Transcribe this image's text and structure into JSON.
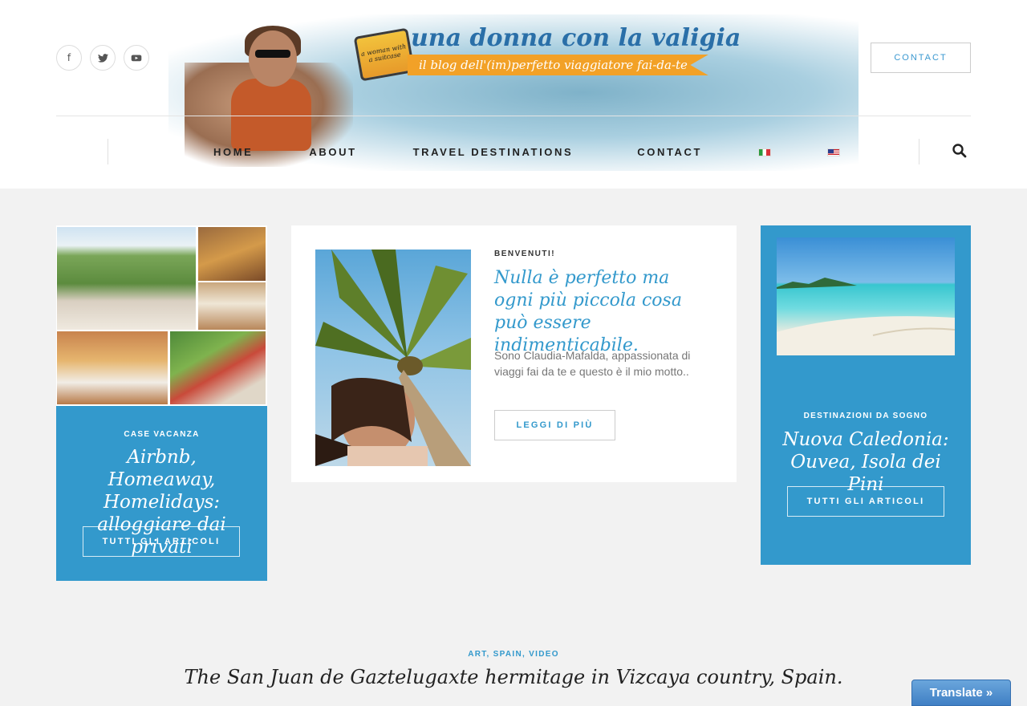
{
  "social": {
    "facebook": "f",
    "twitter": "t",
    "youtube": "▶"
  },
  "logo": {
    "title": "una donna con la valigia",
    "tagline": "il blog dell'(im)perfetto viaggiatore fai-da-te",
    "suitcase_text": "a woman with a suitcase"
  },
  "header": {
    "contact_button": "CONTACT"
  },
  "nav": {
    "items": [
      "HOME",
      "ABOUT",
      "TRAVEL DESTINATIONS",
      "CONTACT"
    ],
    "languages": [
      "it-flag",
      "us-flag"
    ]
  },
  "card_left": {
    "category": "CASE VACANZA",
    "title": "Airbnb, Homeaway, Homelidays: alloggiare dai privati",
    "button": "TUTTI GLI ARTICOLI"
  },
  "card_mid": {
    "category": "BENVENUTI!",
    "title": "Nulla è perfetto ma ogni più piccola cosa può essere indimenticabile.",
    "text": "Sono Claudia-Mafalda, appassionata di viaggi fai da te e questo è il mio motto..",
    "button": "LEGGI DI PIÙ"
  },
  "card_right": {
    "category": "DESTINAZIONI DA SOGNO",
    "title": "Nuova Caledonia: Ouvea, Isola dei Pini",
    "button": "TUTTI GLI ARTICOLI"
  },
  "post": {
    "categories": "ART, SPAIN, VIDEO",
    "title": "The San Juan de Gaztelugaxte hermitage in Vizcaya country, Spain."
  },
  "translate": {
    "label": "Translate »"
  },
  "colors": {
    "accent": "#3399cc",
    "translate_bg": "#4f8fd0"
  }
}
